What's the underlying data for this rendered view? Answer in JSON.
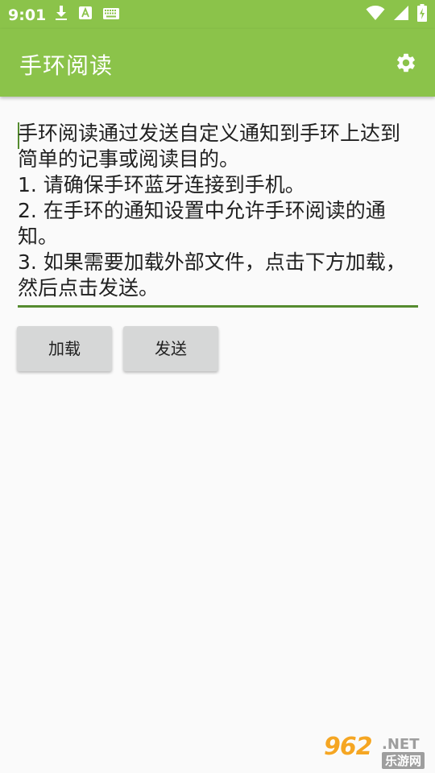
{
  "status_bar": {
    "time": "9:01",
    "left_icons": [
      "download-icon",
      "text-a-icon",
      "keyboard-icon"
    ],
    "right_icons": [
      "wifi-icon",
      "signal-icon",
      "battery-charging-icon"
    ]
  },
  "app_bar": {
    "title": "手环阅读",
    "settings_icon": "gear-icon"
  },
  "editor": {
    "text": "手环阅读通过发送自定义通知到手环上达到简单的记事或阅读目的。\n1. 请确保手环蓝牙连接到手机。\n2. 在手环的通知设置中允许手环阅读的通知。\n3. 如果需要加载外部文件，点击下方加载，然后点击发送。"
  },
  "buttons": {
    "load_label": "加载",
    "send_label": "发送"
  },
  "watermark": {
    "main": "962",
    "net": ".NET",
    "sub": "乐游网"
  },
  "colors": {
    "primary": "#8bc34a",
    "accent": "#558b2f",
    "background": "#fafafa",
    "button": "#d6d7d7"
  }
}
